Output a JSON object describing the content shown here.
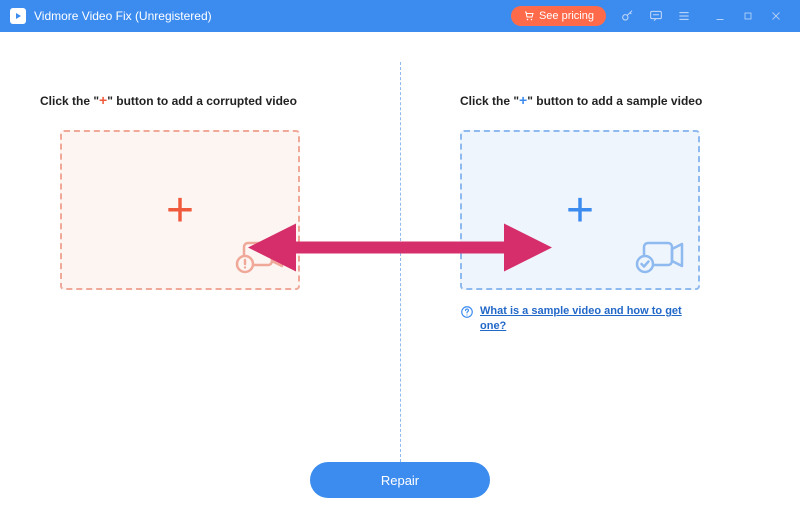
{
  "titlebar": {
    "title": "Vidmore Video Fix (Unregistered)",
    "pricing_label": "See pricing"
  },
  "main": {
    "left": {
      "label_before": "Click the \"",
      "label_plus": "+",
      "label_after": "\" button to add a corrupted video"
    },
    "right": {
      "label_before": "Click the \"",
      "label_plus": "+",
      "label_after": "\" button to add a sample video",
      "help_link": "What is a sample video and how to get one?"
    }
  },
  "footer": {
    "repair_label": "Repair"
  },
  "colors": {
    "accent_blue": "#3c8cf0",
    "accent_red": "#f05a3c",
    "pricing_bg": "#ff6b4a",
    "arrow": "#d62e6a"
  }
}
